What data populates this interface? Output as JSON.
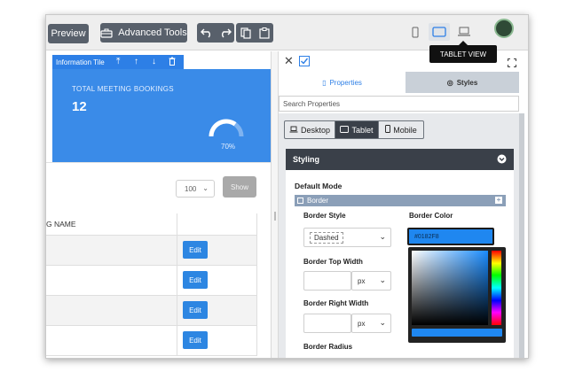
{
  "toolbar": {
    "preview_label": "Preview",
    "advanced_tools_label": "Advanced Tools",
    "tooltip": "TABLET VIEW"
  },
  "canvas": {
    "tile_toolbar_label": "Information Tile",
    "tile": {
      "label": "TOTAL MEETING BOOKINGS",
      "value": "12",
      "percent": "70%",
      "gauge_fraction": 0.7
    },
    "page_size_select": "100",
    "show_label": "Show",
    "table": {
      "header": "G NAME",
      "edit_label": "Edit",
      "rows": 4
    }
  },
  "panel": {
    "tabs": [
      {
        "label": "Properties",
        "icon": "document-icon"
      },
      {
        "label": "Styles",
        "icon": "palette-icon"
      }
    ],
    "search_placeholder": "Search Properties",
    "devices": [
      {
        "label": "Desktop",
        "icon": "laptop-icon",
        "active": false
      },
      {
        "label": "Tablet",
        "icon": "tablet-icon",
        "active": true
      },
      {
        "label": "Mobile",
        "icon": "mobile-icon",
        "active": false
      }
    ],
    "styling_title": "Styling",
    "default_mode_label": "Default Mode",
    "border_section": "Border",
    "border_style_label": "Border Style",
    "border_style_value": "Dashed",
    "border_color_label": "Border Color",
    "border_color_value": "#0182F8",
    "border_top_width_label": "Border Top Width",
    "border_right_width_label": "Border Right Width",
    "unit_value": "px",
    "border_radius_label": "Border Radius"
  },
  "colors": {
    "tile_blue": "#3a8be8",
    "accent_blue": "#2d86e2",
    "dark_header": "#3a4049",
    "toolbar_button": "#58606b"
  }
}
